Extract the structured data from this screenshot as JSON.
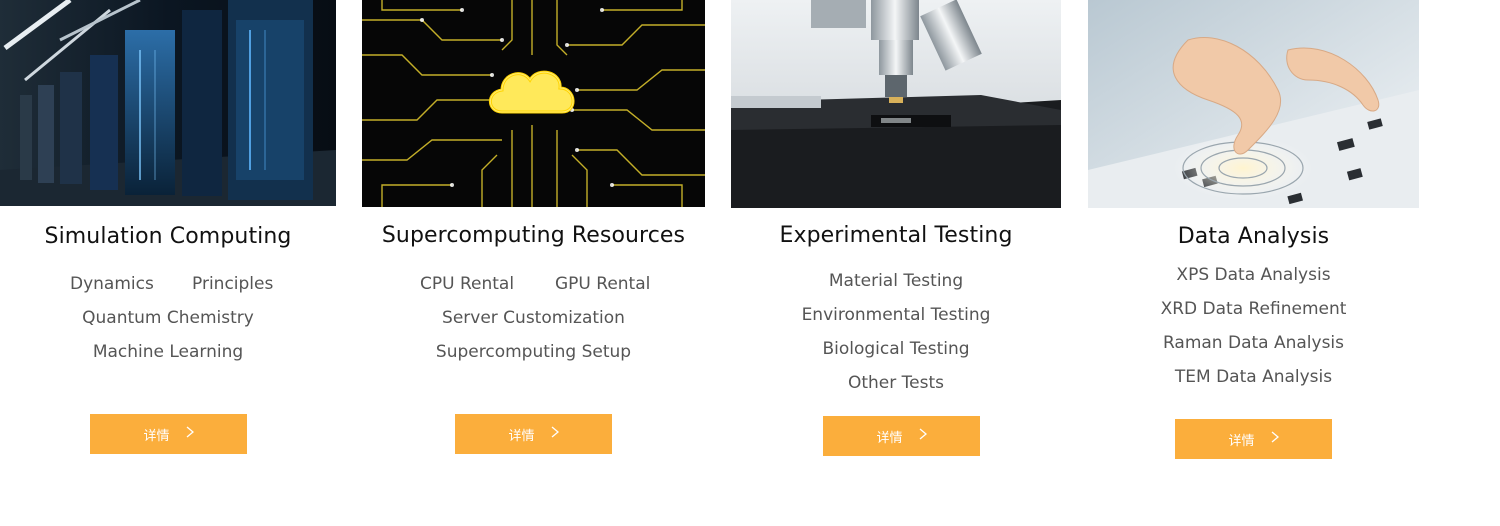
{
  "cards": [
    {
      "title": "Simulation Computing",
      "image": "server-room-image",
      "items": [
        "Dynamics",
        "Principles",
        "Quantum Chemistry",
        "Machine Learning"
      ],
      "button_label": "详情"
    },
    {
      "title": "Supercomputing Resources",
      "image": "circuit-cloud-image",
      "items": [
        "CPU Rental",
        "GPU Rental",
        "Server Customization",
        "Supercomputing Setup"
      ],
      "button_label": "详情"
    },
    {
      "title": "Experimental Testing",
      "image": "microscope-image",
      "items": [
        "Material Testing",
        "Environmental Testing",
        "Biological Testing",
        "Other Tests"
      ],
      "button_label": "详情"
    },
    {
      "title": "Data Analysis",
      "image": "keyboard-hand-image",
      "items": [
        "XPS Data Analysis",
        "XRD Data Refinement",
        "Raman Data Analysis",
        "TEM Data Analysis"
      ],
      "button_label": "详情"
    }
  ],
  "colors": {
    "button_bg": "#fbae3c",
    "button_text": "#ffffff",
    "title_text": "#111111",
    "item_text": "#555555"
  },
  "icons": {
    "button_arrow": "chevron-right-icon"
  }
}
